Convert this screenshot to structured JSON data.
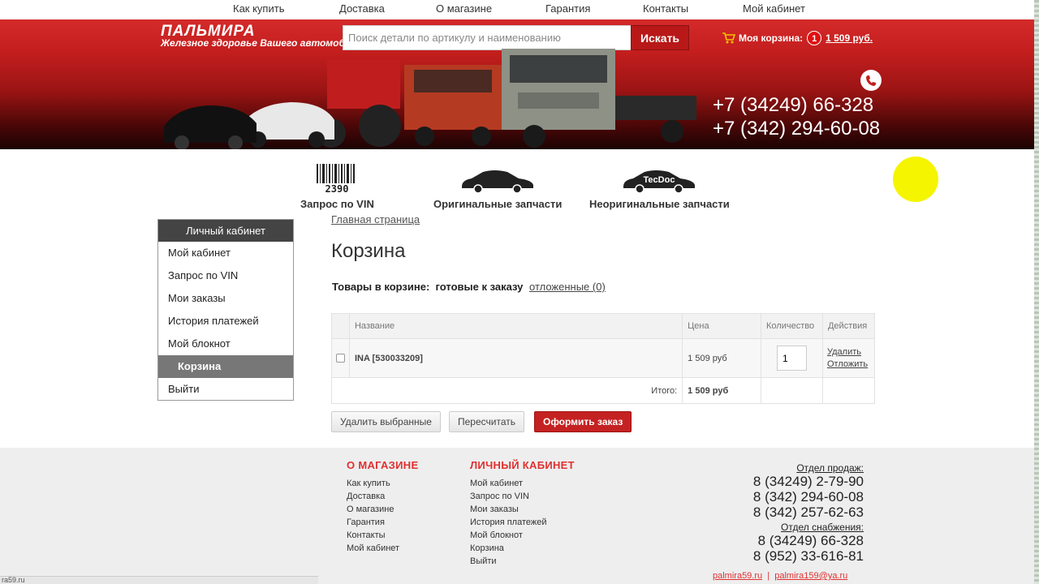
{
  "topnav": [
    "Как купить",
    "Доставка",
    "О магазине",
    "Гарантия",
    "Контакты",
    "Мой кабинет"
  ],
  "header": {
    "logo": "ПАЛЬМИРА",
    "tagline": "Железное здоровье Вашего автомобиля",
    "search_placeholder": "Поиск детали по артикулу и наименованию",
    "search_button": "Искать",
    "cart_label": "Моя корзина:",
    "cart_count": "1",
    "cart_sum": "1 509 руб.",
    "phone1": "+7 (34249) 66-328",
    "phone2": "+7 (342) 294-60-08"
  },
  "categories": [
    {
      "label": "Запрос по VIN",
      "icon": "barcode-icon",
      "code": "2390"
    },
    {
      "label": "Оригинальные запчасти",
      "icon": "car-icon"
    },
    {
      "label": "Неоригинальные запчасти",
      "icon": "tecdoc-car-icon",
      "badge": "TecDoc"
    }
  ],
  "sidebar": {
    "title": "Личный кабинет",
    "items": [
      "Мой кабинет",
      "Запрос по VIN",
      "Мои заказы",
      "История платежей",
      "Мой блокнот",
      "Корзина",
      "Выйти"
    ],
    "active_index": 5
  },
  "main": {
    "breadcrumb": "Главная страница",
    "title": "Корзина",
    "tabs_label": "Товары в корзине:",
    "tab_active": "готовые к заказу",
    "tab_deferred": "отложенные (0)"
  },
  "cart_table": {
    "headers": {
      "name": "Название",
      "price": "Цена",
      "qty": "Количество",
      "actions": "Действия"
    },
    "rows": [
      {
        "name": "INA [530033209]",
        "price": "1 509 руб",
        "qty": "1",
        "action_delete": "Удалить",
        "action_defer": "Отложить"
      }
    ],
    "total_label": "Итого:",
    "total_value": "1 509 руб"
  },
  "buttons": {
    "delete_selected": "Удалить выбранные",
    "recalculate": "Пересчитать",
    "checkout": "Оформить заказ"
  },
  "footer": {
    "col1_title": "О МАГАЗИНЕ",
    "col1_links": [
      "Как купить",
      "Доставка",
      "О магазине",
      "Гарантия",
      "Контакты",
      "Мой кабинет"
    ],
    "col2_title": "ЛИЧНЫЙ КАБИНЕТ",
    "col2_links": [
      "Мой кабинет",
      "Запрос по VIN",
      "Мои заказы",
      "История платежей",
      "Мой блокнот",
      "Корзина",
      "Выйти"
    ],
    "sales_dept": "Отдел продаж:",
    "sales_phones": [
      "8 (34249) 2-79-90",
      "8 (342) 294-60-08",
      "8 (342) 257-62-63"
    ],
    "supply_dept": "Отдел снабжения:",
    "supply_phones": [
      "8 (34249) 66-328",
      "8 (952) 33-616-81"
    ],
    "email1": "palmira59.ru",
    "email2": "palmira159@ya.ru",
    "status_text": "ra59.ru"
  },
  "colors": {
    "brand_red": "#c41e1e",
    "footer_heading": "#e03030",
    "highlight": "#f5f500"
  }
}
